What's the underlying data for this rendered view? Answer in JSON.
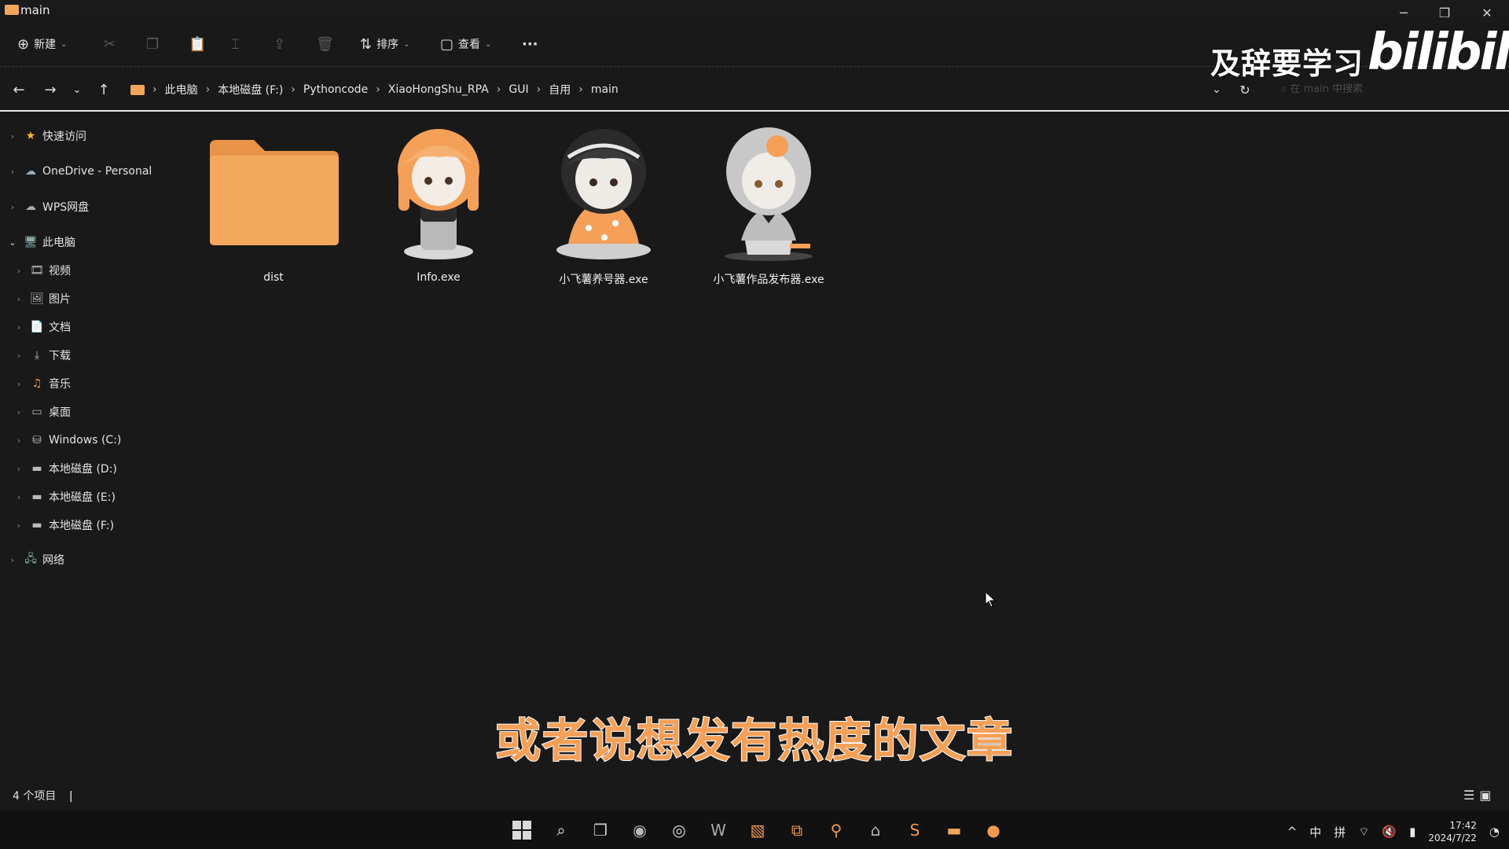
{
  "window": {
    "title": "main"
  },
  "commands": {
    "new_label": "新建",
    "sort_label": "排序",
    "view_label": "查看",
    "more": "···"
  },
  "watermark": {
    "text": "及辞要学习",
    "logo": "bilibili"
  },
  "breadcrumb": [
    "此电脑",
    "本地磁盘 (F:)",
    "Pythoncode",
    "XiaoHongShu_RPA",
    "GUI",
    "自用",
    "main"
  ],
  "search": {
    "placeholder": "在 main 中搜索"
  },
  "sidebar": {
    "quick_access": "快速访问",
    "onedrive": "OneDrive - Personal",
    "wps": "WPS网盘",
    "this_pc": "此电脑",
    "pc_items": [
      "视频",
      "图片",
      "文档",
      "下载",
      "音乐",
      "桌面",
      "Windows (C:)",
      "本地磁盘 (D:)",
      "本地磁盘 (E:)",
      "本地磁盘 (F:)"
    ],
    "network": "网络"
  },
  "files": [
    {
      "name": "dist",
      "kind": "folder"
    },
    {
      "name": "Info.exe",
      "kind": "figure-orange-hair"
    },
    {
      "name": "小飞薯养号器.exe",
      "kind": "figure-orange-dress"
    },
    {
      "name": "小飞薯作品发布器.exe",
      "kind": "figure-silver"
    }
  ],
  "status": {
    "count": "4 个项目"
  },
  "subtitle": "或者说想发有热度的文章",
  "tray": {
    "ime1": "中",
    "ime2": "拼",
    "time": "17:42",
    "date": "2024/7/22"
  },
  "colors": {
    "accent": "#f2a65a",
    "background": "#191919",
    "subtitle_fill": "#f4a058"
  }
}
